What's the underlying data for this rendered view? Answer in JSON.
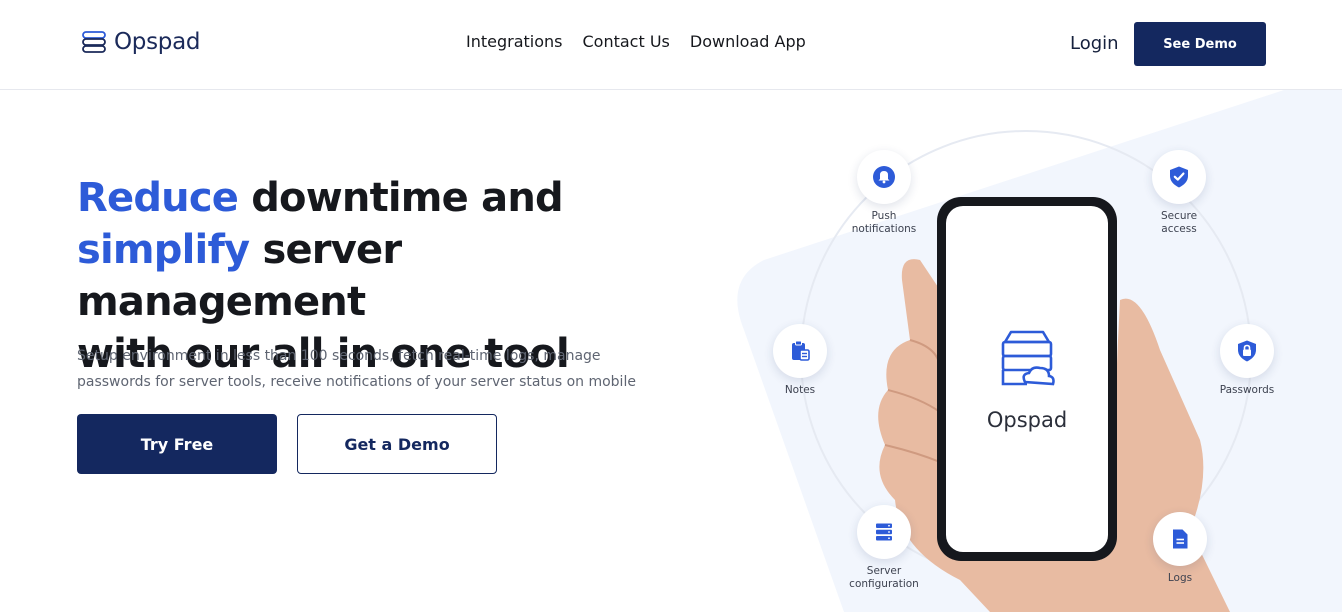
{
  "header": {
    "logo_text": "Opspad",
    "nav": [
      "Integrations",
      "Contact Us",
      "Download App"
    ],
    "login_label": "Login",
    "see_demo_label": "See Demo"
  },
  "hero": {
    "title_parts": {
      "accent1": "Reduce",
      "part1": " downtime and",
      "accent2": "simplify",
      "part2": " server management",
      "line3": "with our all in one tool"
    },
    "subtitle_line1": "Setup environment in less than 100 seconds, fetch real-time logs, manage",
    "subtitle_line2": "passwords for server tools, receive notifications of your server status on mobile",
    "try_free_label": "Try Free",
    "get_demo_label": "Get a Demo"
  },
  "illustration": {
    "phone_brand": "Opspad",
    "features": [
      {
        "label": "Push notifications",
        "line1": "Push",
        "line2": "notifications",
        "icon": "bell-icon"
      },
      {
        "label": "Secure access",
        "line1": "Secure",
        "line2": "access",
        "icon": "shield-check-icon"
      },
      {
        "label": "Notes",
        "line1": "Notes",
        "line2": "",
        "icon": "clipboard-icon"
      },
      {
        "label": "Passwords",
        "line1": "Passwords",
        "line2": "",
        "icon": "lock-icon"
      },
      {
        "label": "Server configuration",
        "line1": "Server",
        "line2": "configuration",
        "icon": "server-icon"
      },
      {
        "label": "Logs",
        "line1": "Logs",
        "line2": "",
        "icon": "document-icon"
      }
    ]
  },
  "colors": {
    "brand_navy": "#14285f",
    "accent_blue": "#2d5bd8",
    "bg_tint": "#f2f6fd"
  }
}
